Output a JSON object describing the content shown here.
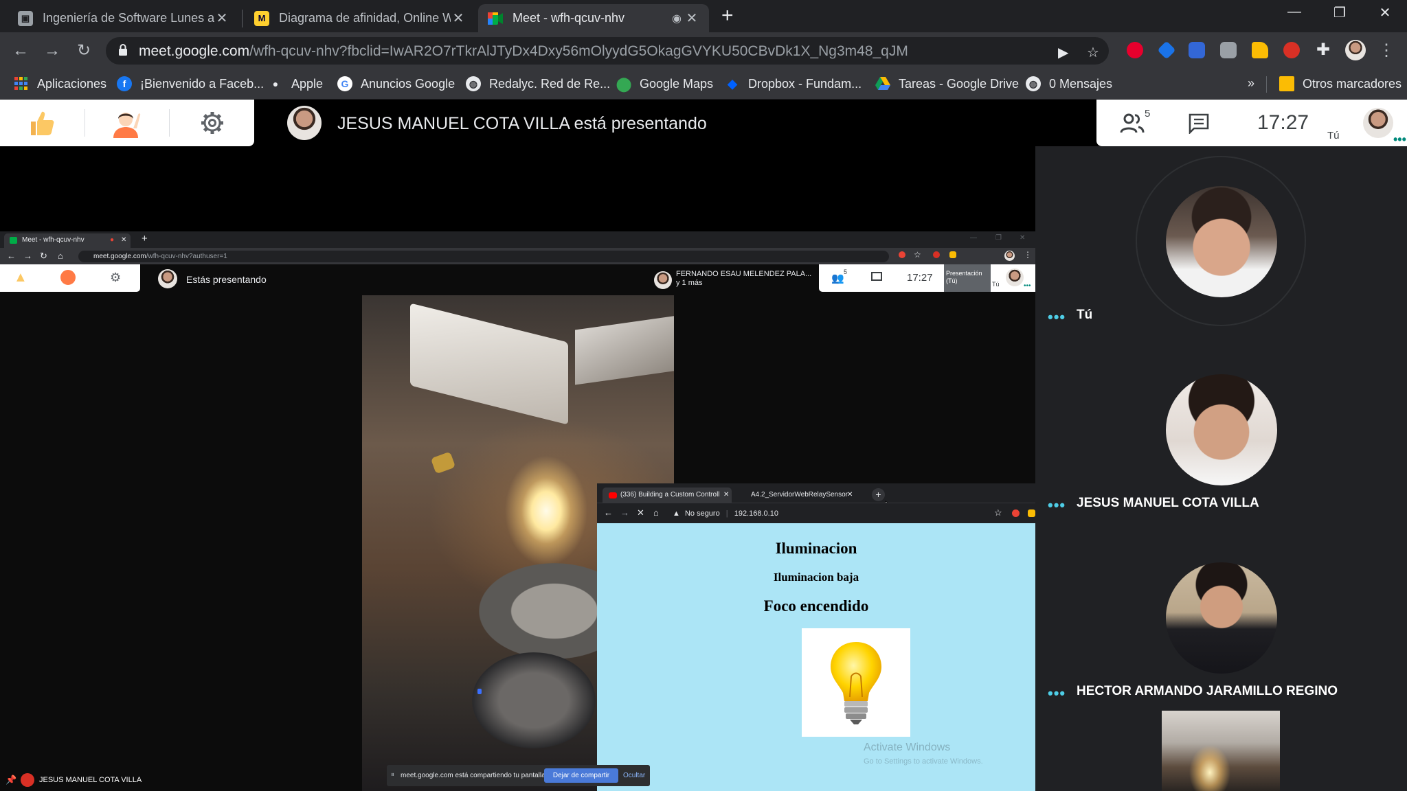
{
  "browser": {
    "tabs": [
      {
        "title": "Ingeniería de Software Lunes a Vi",
        "favicon": "classroom-icon",
        "active": false
      },
      {
        "title": "Diagrama de afinidad, Online Wh",
        "favicon": "miro-icon",
        "active": false
      },
      {
        "title": "Meet - wfh-qcuv-nhv",
        "favicon": "meet-icon",
        "active": true
      }
    ],
    "url_host": "meet.google.com",
    "url_path": "/wfh-qcuv-nhv?fbclid=IwAR2O7rTkrAlJTyDx4Dxy56mOlyydG5OkagGVYKU50CBvDk1X_Ng3m48_qJM",
    "bookmarks": [
      {
        "label": "Aplicaciones",
        "icon": "apps-grid-icon"
      },
      {
        "label": "¡Bienvenido a Faceb...",
        "icon": "facebook-icon"
      },
      {
        "label": "Apple",
        "icon": "apple-icon"
      },
      {
        "label": "Anuncios Google",
        "icon": "google-icon"
      },
      {
        "label": "Redalyc. Red de Re...",
        "icon": "globe-icon"
      },
      {
        "label": "Google Maps",
        "icon": "maps-pin-icon"
      },
      {
        "label": "Dropbox - Fundam...",
        "icon": "dropbox-icon"
      },
      {
        "label": "Tareas - Google Drive",
        "icon": "drive-icon"
      },
      {
        "label": "0 Mensajes",
        "icon": "globe-icon"
      }
    ],
    "bookmarks_more": "»",
    "other_bookmarks": "Otros marcadores"
  },
  "meet": {
    "presenter_title": "JESUS MANUEL COTA VILLA está presentando",
    "participant_count": "5",
    "time": "17:27",
    "you_label": "Tú"
  },
  "shared_screen": {
    "tab_title": "Meet - wfh-qcuv-nhv",
    "url_host": "meet.google.com",
    "url_path": "/wfh-qcuv-nhv?authuser=1",
    "presenting_text": "Estás presentando",
    "other_presenter_name": "FERNANDO ESAU MELENDEZ PALA...",
    "other_presenter_more": "y 1 más",
    "participant_count": "5",
    "time": "17:27",
    "presentation_label": "Presentación (Tú)",
    "you_label": "Tú",
    "subwindow": {
      "tabs": [
        "(336) Building a Custom Controll",
        "A4.2_ServidorWebRelaySensor"
      ],
      "not_secure": "No seguro",
      "address": "192.168.0.10",
      "heading": "Iluminacion",
      "status": "Iluminacion baja",
      "bulb_state": "Foco encendido",
      "activate_title": "Activate Windows",
      "activate_sub": "Go to Settings to activate Windows."
    },
    "share_notice": "meet.google.com está compartiendo tu pantalla.",
    "stop_sharing": "Dejar de compartir",
    "hide": "Ocultar",
    "bottom_name": "JESUS MANUEL COTA VILLA"
  },
  "participants": [
    {
      "name": "Tú"
    },
    {
      "name": "JESUS MANUEL COTA VILLA"
    },
    {
      "name": "HECTOR ARMANDO JARAMILLO REGINO"
    }
  ],
  "colors": {
    "accent_teal": "#4ecde6",
    "meet_green": "#00897b",
    "stop_share_blue": "#4a7ad8",
    "page_bg": "#ace5f6"
  }
}
